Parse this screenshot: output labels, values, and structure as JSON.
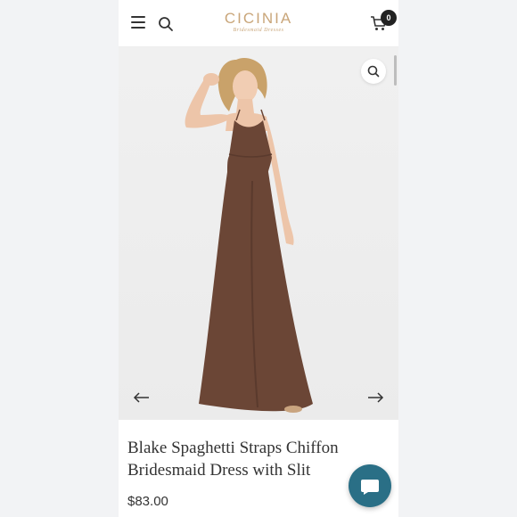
{
  "header": {
    "logo_main": "CICINIA",
    "logo_sub": "Bridesmaid Dresses",
    "cart_count": "0",
    "icons": [
      "menu-icon",
      "search-icon",
      "cart-icon"
    ]
  },
  "gallery": {
    "icons": [
      "zoom-icon",
      "arrow-left-icon",
      "arrow-right-icon"
    ],
    "dress_color": "#6b4636"
  },
  "product": {
    "title": "Blake Spaghetti Straps Chiffon Bridesmaid Dress with Slit",
    "price": "$83.00"
  },
  "chat": {
    "icon": "chat-icon"
  },
  "colors": {
    "brand": "#c9a67a",
    "chat": "#2a6f86"
  }
}
